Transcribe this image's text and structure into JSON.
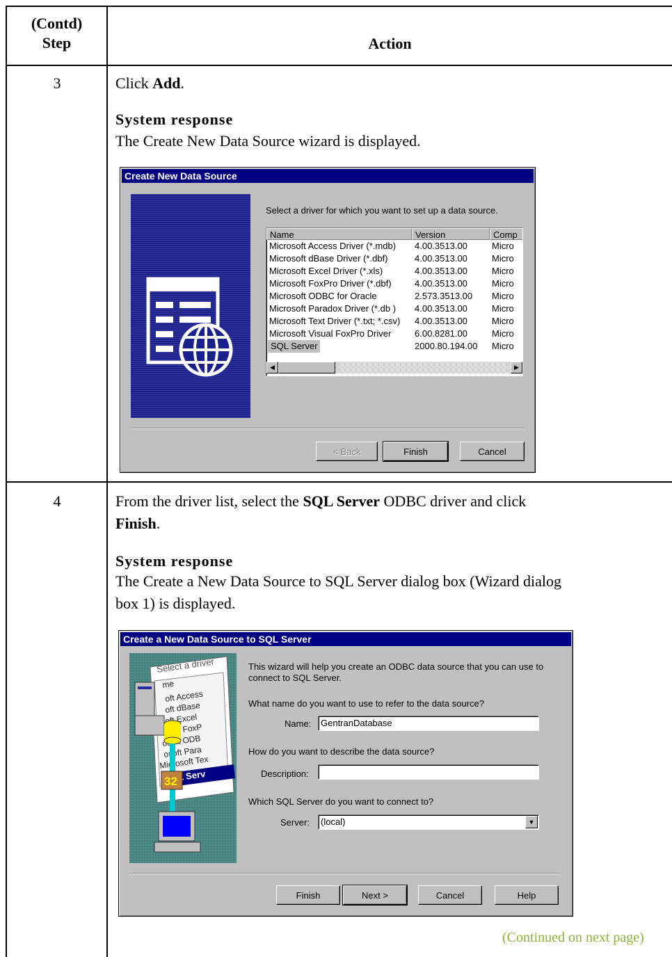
{
  "header": {
    "step_label_line1": "(Contd)",
    "step_label_line2": "Step",
    "action_label": "Action"
  },
  "step3": {
    "number": "3",
    "instruction_prefix": "Click ",
    "instruction_bold": "Add",
    "instruction_suffix": ".",
    "system_response_label": "System response",
    "system_response_text": "The Create New Data Source wizard is displayed.",
    "dialog": {
      "title": "Create New Data Source",
      "prompt": "Select a driver for which you want to set up a data source.",
      "columns": [
        "Name",
        "Version",
        "Comp"
      ],
      "rows": [
        {
          "name": "Microsoft Access Driver (*.mdb)",
          "version": "4.00.3513.00",
          "company": "Micro"
        },
        {
          "name": "Microsoft dBase Driver (*.dbf)",
          "version": "4.00.3513.00",
          "company": "Micro"
        },
        {
          "name": "Microsoft Excel Driver (*.xls)",
          "version": "4.00.3513.00",
          "company": "Micro"
        },
        {
          "name": "Microsoft FoxPro Driver (*.dbf)",
          "version": "4.00.3513.00",
          "company": "Micro"
        },
        {
          "name": "Microsoft ODBC for Oracle",
          "version": "2.573.3513.00",
          "company": "Micro"
        },
        {
          "name": "Microsoft Paradox Driver (*.db )",
          "version": "4.00.3513.00",
          "company": "Micro"
        },
        {
          "name": "Microsoft Text Driver (*.txt; *.csv)",
          "version": "4.00.3513.00",
          "company": "Micro"
        },
        {
          "name": "Microsoft Visual FoxPro Driver",
          "version": "6.00.8281.00",
          "company": "Micro"
        },
        {
          "name": "SQL Server",
          "version": "2000.80.194.00",
          "company": "Micro"
        }
      ],
      "selected_row": "SQL Server",
      "back_label": "< Back",
      "finish_label": "Finish",
      "cancel_label": "Cancel"
    }
  },
  "step4": {
    "number": "4",
    "instruction_line1_prefix": "From the driver list, select the ",
    "instruction_line1_bold": "SQL Server",
    "instruction_line1_suffix": " ODBC driver and click",
    "instruction_line2_bold": "Finish",
    "instruction_line2_suffix": ".",
    "system_response_label": "System response",
    "system_response_line1": "The Create a New Data Source to SQL Server dialog box (Wizard dialog",
    "system_response_line2": "box 1) is displayed.",
    "dialog": {
      "title": "Create a New Data Source to SQL Server",
      "intro_line1": "This wizard will help you create an ODBC data source that you can use to",
      "intro_line2": "connect to SQL Server.",
      "name_question": "What name do you want to use to refer to the data source?",
      "name_label": "Name:",
      "name_value": "GentranDatabase",
      "desc_question": "How do you want to describe the data source?",
      "desc_label": "Description:",
      "desc_value": "",
      "server_question": "Which SQL Server do you want to connect to?",
      "server_label": "Server:",
      "server_value": "(local)",
      "finish_label": "Finish",
      "next_label": "Next >",
      "cancel_label": "Cancel",
      "help_label": "Help",
      "art_lines": [
        "Select a driver",
        "me",
        "oft Access",
        "oft dBase",
        "oft Excel",
        "osoft FoxP",
        "osoft ODB",
        "osoft Para",
        "Microsoft Tex",
        "SQL Serv"
      ]
    }
  },
  "footer": {
    "continued": "(Continued on next page)"
  },
  "colors": {
    "title_bar": "#000080",
    "dialog_face": "#c0c0c0",
    "continued_text": "#8db33a"
  }
}
